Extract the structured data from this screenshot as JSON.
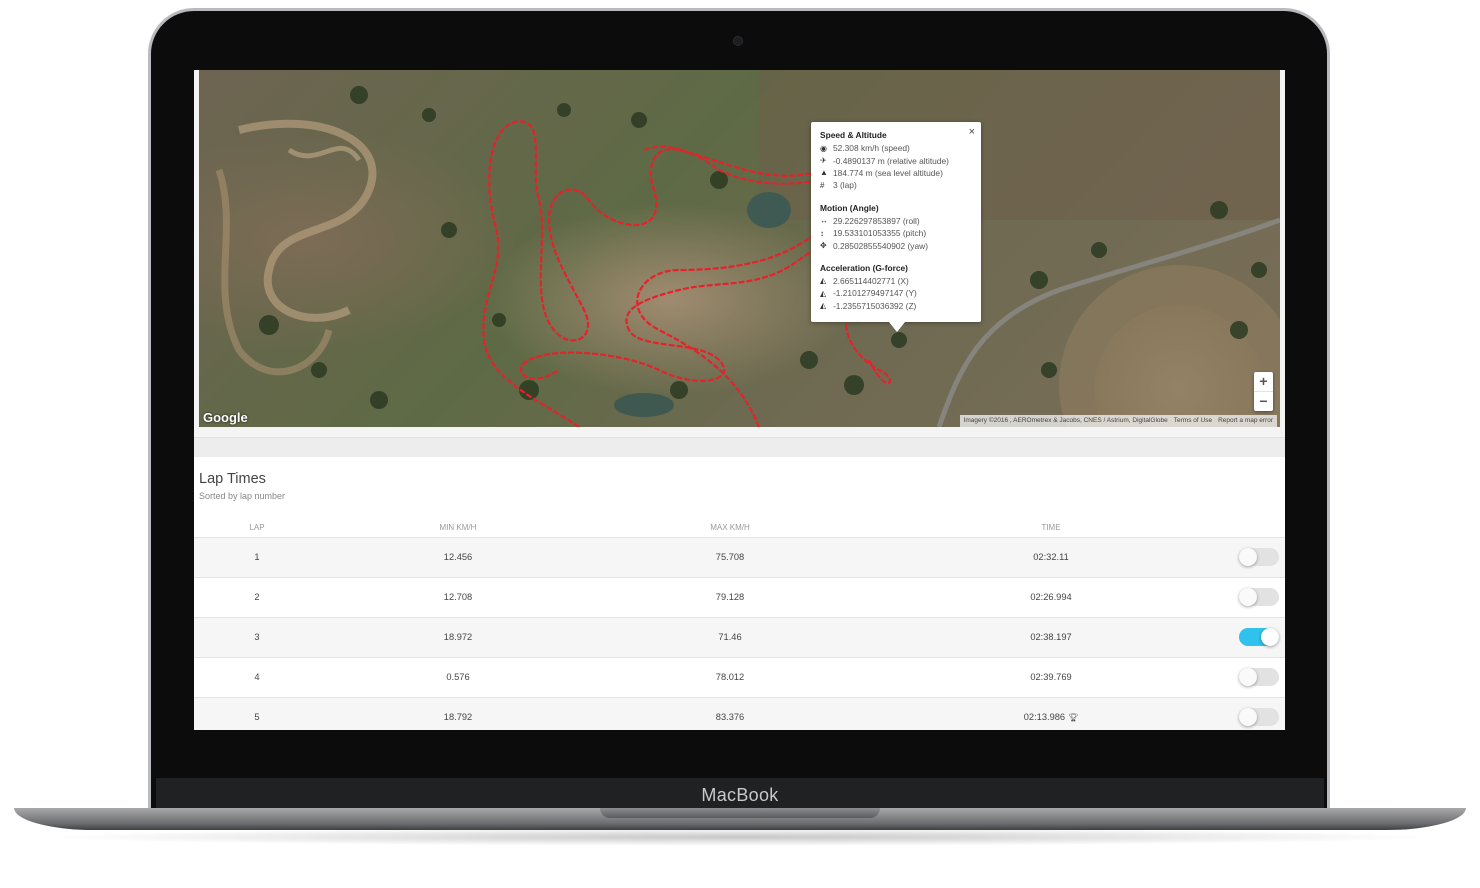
{
  "device": {
    "brand": "MacBook"
  },
  "map": {
    "provider_logo": "Google",
    "attribution": {
      "imagery": "Imagery ©2016 , AEROmetrex & Jacobs, CNES / Astrium, DigitalGlobe",
      "terms": "Terms of Use",
      "report": "Report a map error"
    },
    "zoom_in": "+",
    "zoom_out": "−",
    "track_color": "#e5222a"
  },
  "popup": {
    "close": "×",
    "speed_title": "Speed & Altitude",
    "speed": "52.308 km/h (speed)",
    "rel_alt": "-0.4890137 m (relative altitude)",
    "sea_alt": "184.774 m (sea level altitude)",
    "lap": "3 (lap)",
    "motion_title": "Motion (Angle)",
    "roll": "29.226297853897 (roll)",
    "pitch": "19.533101053355 (pitch)",
    "yaw": "0.28502855540902 (yaw)",
    "accel_title": "Acceleration (G-force)",
    "ax": "2.665114402771 (X)",
    "ay": "-1.2101279497147 (Y)",
    "az": "-1.2355715036392 (Z)"
  },
  "laps": {
    "title": "Lap Times",
    "subtitle": "Sorted by lap number",
    "columns": {
      "lap": "LAP",
      "min": "MIN KM/H",
      "max": "MAX KM/H",
      "time": "TIME"
    },
    "rows": [
      {
        "lap": "1",
        "min": "12.456",
        "max": "75.708",
        "time": "02:32.11",
        "selected": false,
        "best": false
      },
      {
        "lap": "2",
        "min": "12.708",
        "max": "79.128",
        "time": "02:26.994",
        "selected": false,
        "best": false
      },
      {
        "lap": "3",
        "min": "18.972",
        "max": "71.46",
        "time": "02:38.197",
        "selected": true,
        "best": false
      },
      {
        "lap": "4",
        "min": "0.576",
        "max": "78.012",
        "time": "02:39.769",
        "selected": false,
        "best": false
      },
      {
        "lap": "5",
        "min": "18.792",
        "max": "83.376",
        "time": "02:13.986",
        "selected": false,
        "best": true
      }
    ],
    "accent_color": "#2ec2ec"
  }
}
